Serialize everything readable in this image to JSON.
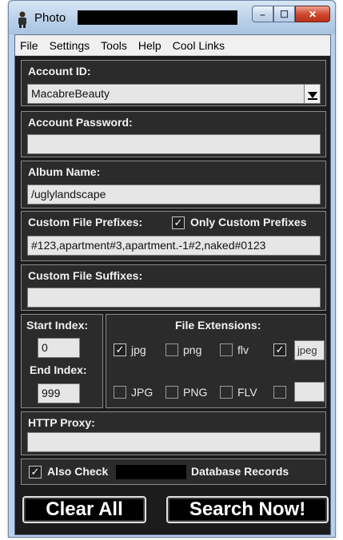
{
  "window": {
    "title": "Photo",
    "minimize_label": "–",
    "maximize_label": "☐",
    "close_label": "✕"
  },
  "menu": [
    "File",
    "Settings",
    "Tools",
    "Help",
    "Cool Links"
  ],
  "account_id": {
    "label": "Account ID:",
    "value": "MacabreBeauty"
  },
  "account_password": {
    "label": "Account Password:",
    "value": ""
  },
  "album_name": {
    "label": "Album Name:",
    "value": "/uglylandscape"
  },
  "custom_prefixes": {
    "label": "Custom File Prefixes:",
    "only_custom_label": "Only Custom Prefixes",
    "only_custom_checked": true,
    "value": "#123,apartment#3,apartment.-1#2,naked#0123"
  },
  "custom_suffixes": {
    "label": "Custom File Suffixes:",
    "value": ""
  },
  "index": {
    "start_label": "Start Index:",
    "start_value": "0",
    "end_label": "End Index:",
    "end_value": "999"
  },
  "extensions": {
    "label": "File Extensions:",
    "row1": [
      {
        "label": "jpg",
        "checked": true
      },
      {
        "label": "png",
        "checked": false
      },
      {
        "label": "flv",
        "checked": false
      },
      {
        "label": "",
        "checked": true
      }
    ],
    "row1_custom": "jpeg",
    "row2": [
      {
        "label": "JPG",
        "checked": false
      },
      {
        "label": "PNG",
        "checked": false
      },
      {
        "label": "FLV",
        "checked": false
      },
      {
        "label": "",
        "checked": false
      }
    ],
    "row2_custom": ""
  },
  "http_proxy": {
    "label": "HTTP Proxy:",
    "value": ""
  },
  "also_check": {
    "checked": true,
    "label_prefix": "Also Check",
    "label_suffix": "Database Records"
  },
  "buttons": {
    "clear": "Clear All",
    "search": "Search Now!"
  }
}
